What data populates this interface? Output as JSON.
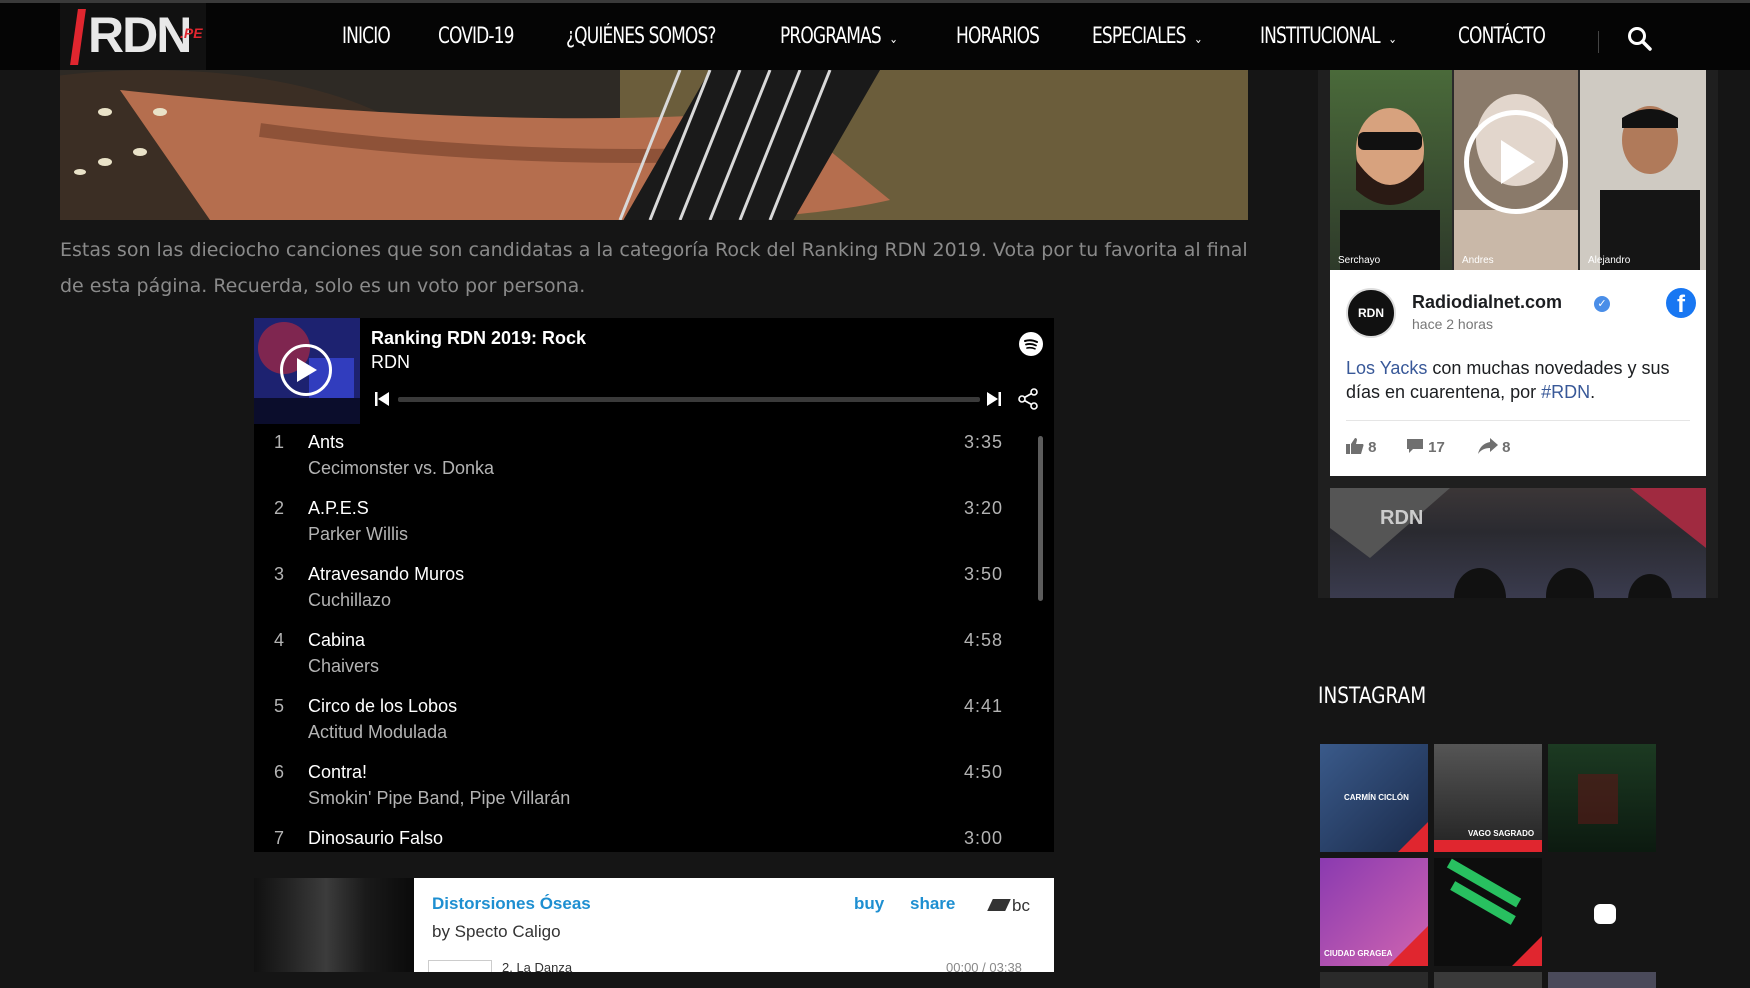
{
  "nav": {
    "logo_text": "RDN",
    "logo_suffix": ".PE",
    "items": [
      {
        "label": "INICIO",
        "dropdown": false
      },
      {
        "label": "COVID-19",
        "dropdown": false
      },
      {
        "label": "¿QUIÉNES SOMOS?",
        "dropdown": false
      },
      {
        "label": "PROGRAMAS",
        "dropdown": true
      },
      {
        "label": "HORARIOS",
        "dropdown": false
      },
      {
        "label": "ESPECIALES",
        "dropdown": true
      },
      {
        "label": "INSTITUCIONAL",
        "dropdown": true
      },
      {
        "label": "CONTÁCTO",
        "dropdown": false
      }
    ],
    "search_icon": "search-icon"
  },
  "article": {
    "intro": "Estas son las dieciocho canciones que son candidatas a la categoría Rock del Ranking RDN 2019. Vota por tu favorita al final de esta página. Recuerda, solo es un voto por persona."
  },
  "spotify": {
    "playlist_title": "Ranking RDN 2019: Rock",
    "owner": "RDN",
    "tracks": [
      {
        "num": "1",
        "name": "Ants",
        "artist": "Cecimonster vs. Donka",
        "duration": "3:35"
      },
      {
        "num": "2",
        "name": "A.P.E.S",
        "artist": "Parker Willis",
        "duration": "3:20"
      },
      {
        "num": "3",
        "name": "Atravesando Muros",
        "artist": "Cuchillazo",
        "duration": "3:50"
      },
      {
        "num": "4",
        "name": "Cabina",
        "artist": "Chaivers",
        "duration": "4:58"
      },
      {
        "num": "5",
        "name": "Circo de los Lobos",
        "artist": "Actitud Modulada",
        "duration": "4:41"
      },
      {
        "num": "6",
        "name": "Contra!",
        "artist": "Smokin' Pipe Band, Pipe Villarán",
        "duration": "4:50"
      },
      {
        "num": "7",
        "name": "Dinosaurio Falso",
        "artist": "",
        "duration": "3:00"
      }
    ]
  },
  "bandcamp": {
    "album": "Distorsiones Óseas",
    "by": "by Specto Caligo",
    "buy": "buy",
    "share": "share",
    "logo": "bc",
    "track": "2. La Danza",
    "time": "00:00 / 03:38"
  },
  "facebook": {
    "video_names": [
      "Serchayo",
      "Andres",
      "Alejandro"
    ],
    "page_name": "Radiodialnet.com",
    "time": "hace 2 horas",
    "post_link1": "Los Yacks",
    "post_mid": " con muchas novedades y sus días en cuarentena, por ",
    "post_link2": "#RDN",
    "post_end": ".",
    "likes": "8",
    "comments": "17",
    "shares": "8",
    "avatar_text": "RDN"
  },
  "instagram": {
    "title": "INSTAGRAM",
    "tiles": [
      {
        "label": "CARMÍN CICLÓN",
        "color": "#2b3a5c"
      },
      {
        "label": "VAGO SAGRADO",
        "color": "#2a2a2a"
      },
      {
        "label": "",
        "color": "#15301a"
      },
      {
        "label": "CIUDAD GRAGEA",
        "color": "#6a2b8a"
      },
      {
        "label": "",
        "color": "#0d0d0d"
      },
      {
        "label": "",
        "color": "#151515"
      }
    ]
  }
}
